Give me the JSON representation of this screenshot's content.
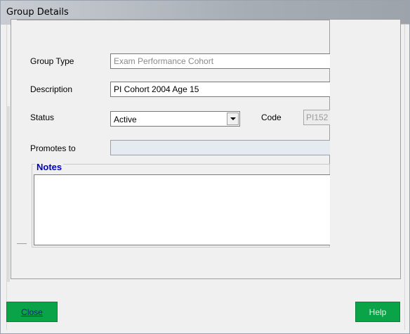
{
  "window": {
    "title": "Group Details"
  },
  "fields": {
    "group_type_label": "Group Type",
    "group_type_value": "Exam Performance Cohort",
    "description_label": "Description",
    "description_value": "PI Cohort 2004 Age 15",
    "status_label": "Status",
    "status_value": "Active",
    "code_label": "Code",
    "code_value": "PI152",
    "promotes_label": "Promotes to",
    "promotes_value": ""
  },
  "notes": {
    "legend": "Notes",
    "value": ""
  },
  "buttons": {
    "close": "Close",
    "help": "Help"
  },
  "icons": {
    "dropdown": "chevron-down-icon"
  },
  "colors": {
    "notes_legend": "#0000c8",
    "button_green": "#0aa347",
    "titlebar": "#b9bec5"
  }
}
